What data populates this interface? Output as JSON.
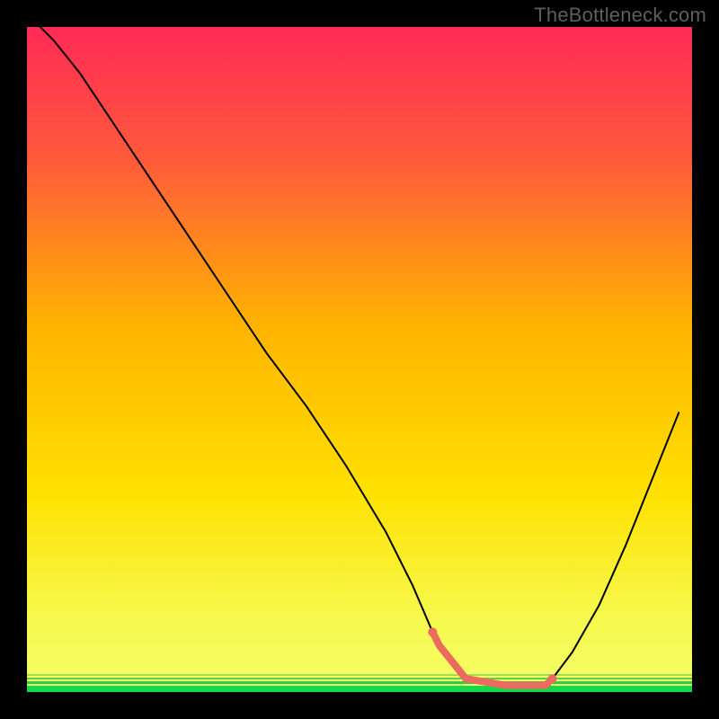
{
  "watermark": "TheBottleneck.com",
  "chart_data": {
    "type": "line",
    "title": "",
    "xlabel": "",
    "ylabel": "",
    "xlim": [
      0,
      100
    ],
    "ylim": [
      0,
      100
    ],
    "grid": false,
    "background_gradient": {
      "top_color": "#ff2a55",
      "mid_color": "#ffd400",
      "bottom_band_color": "#f4ff6a",
      "thin_green_color": "#13d84a"
    },
    "series": [
      {
        "name": "bottleneck-curve",
        "stroke": "#000000",
        "stroke_width": 2,
        "x": [
          2,
          4,
          8,
          12,
          18,
          24,
          30,
          36,
          42,
          48,
          54,
          58,
          61,
          62,
          66,
          72,
          78,
          79,
          82,
          86,
          90,
          94,
          98
        ],
        "values": [
          100,
          98,
          93,
          87,
          78,
          69,
          60,
          51,
          43,
          34,
          24,
          16,
          9,
          7,
          2,
          1,
          1,
          2,
          6,
          13,
          22,
          32,
          42
        ]
      }
    ],
    "annotations": [
      {
        "name": "optimal-range-marker",
        "type": "highlight-segment",
        "stroke": "#ed6a5e",
        "fill": "#ed6a5e",
        "stroke_width": 8,
        "x": [
          61,
          62,
          66,
          72,
          78,
          79
        ],
        "values": [
          9,
          7,
          2,
          1,
          1,
          2
        ]
      }
    ]
  }
}
